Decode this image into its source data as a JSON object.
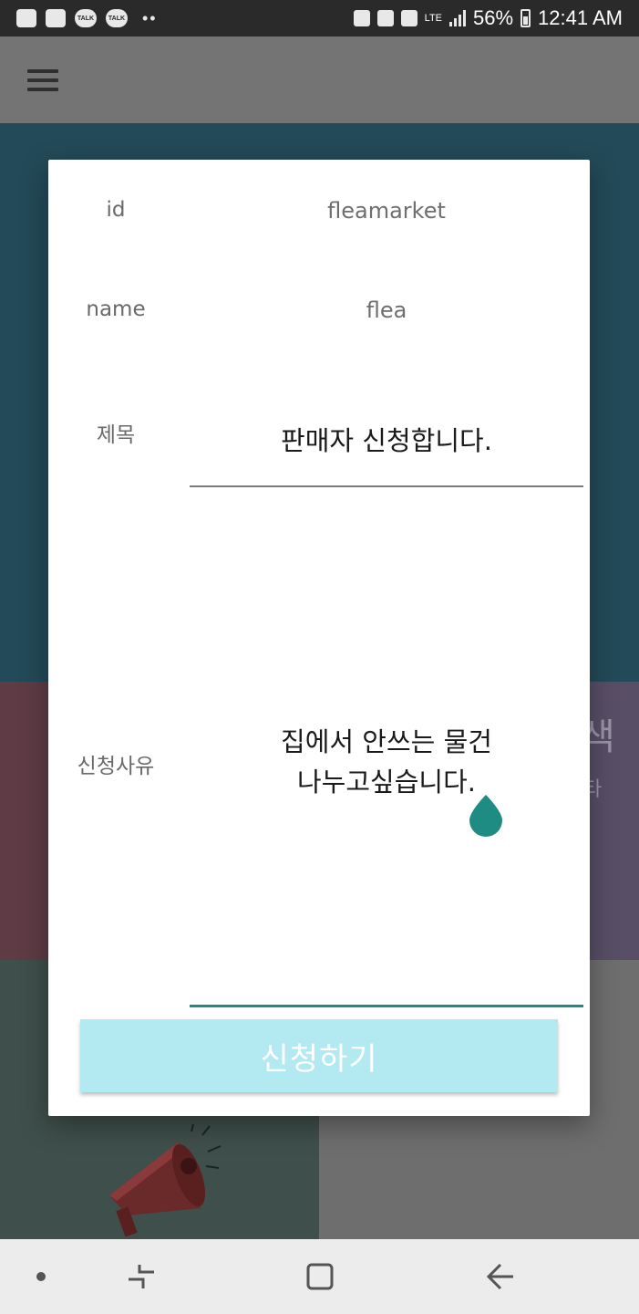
{
  "status_bar": {
    "talk_label": "TALK",
    "network": "LTE",
    "battery": "56%",
    "time": "12:41 AM"
  },
  "dialog": {
    "id_label": "id",
    "id_value": "fleamarket",
    "name_label": "name",
    "name_value": "flea",
    "title_label": "제목",
    "title_value": "판매자 신청합니다.",
    "reason_label": "신청사유",
    "reason_lines": [
      "집에서 안쓰는 물건",
      "나누고싶습니다."
    ],
    "submit_label": "신청하기"
  },
  "background": {
    "right_tile_title": "색",
    "right_tile_sub": "타"
  },
  "colors": {
    "accent_teal": "#1f8c84",
    "submit_button": "#b3eaf2",
    "tile_blue": "#234a58"
  },
  "icons": {
    "menu": "hamburger-icon",
    "megaphone": "megaphone-icon",
    "text_cursor": "text-cursor-handle-icon",
    "nav_recent": "recent-apps-icon",
    "nav_home": "home-icon",
    "nav_back": "back-icon"
  }
}
